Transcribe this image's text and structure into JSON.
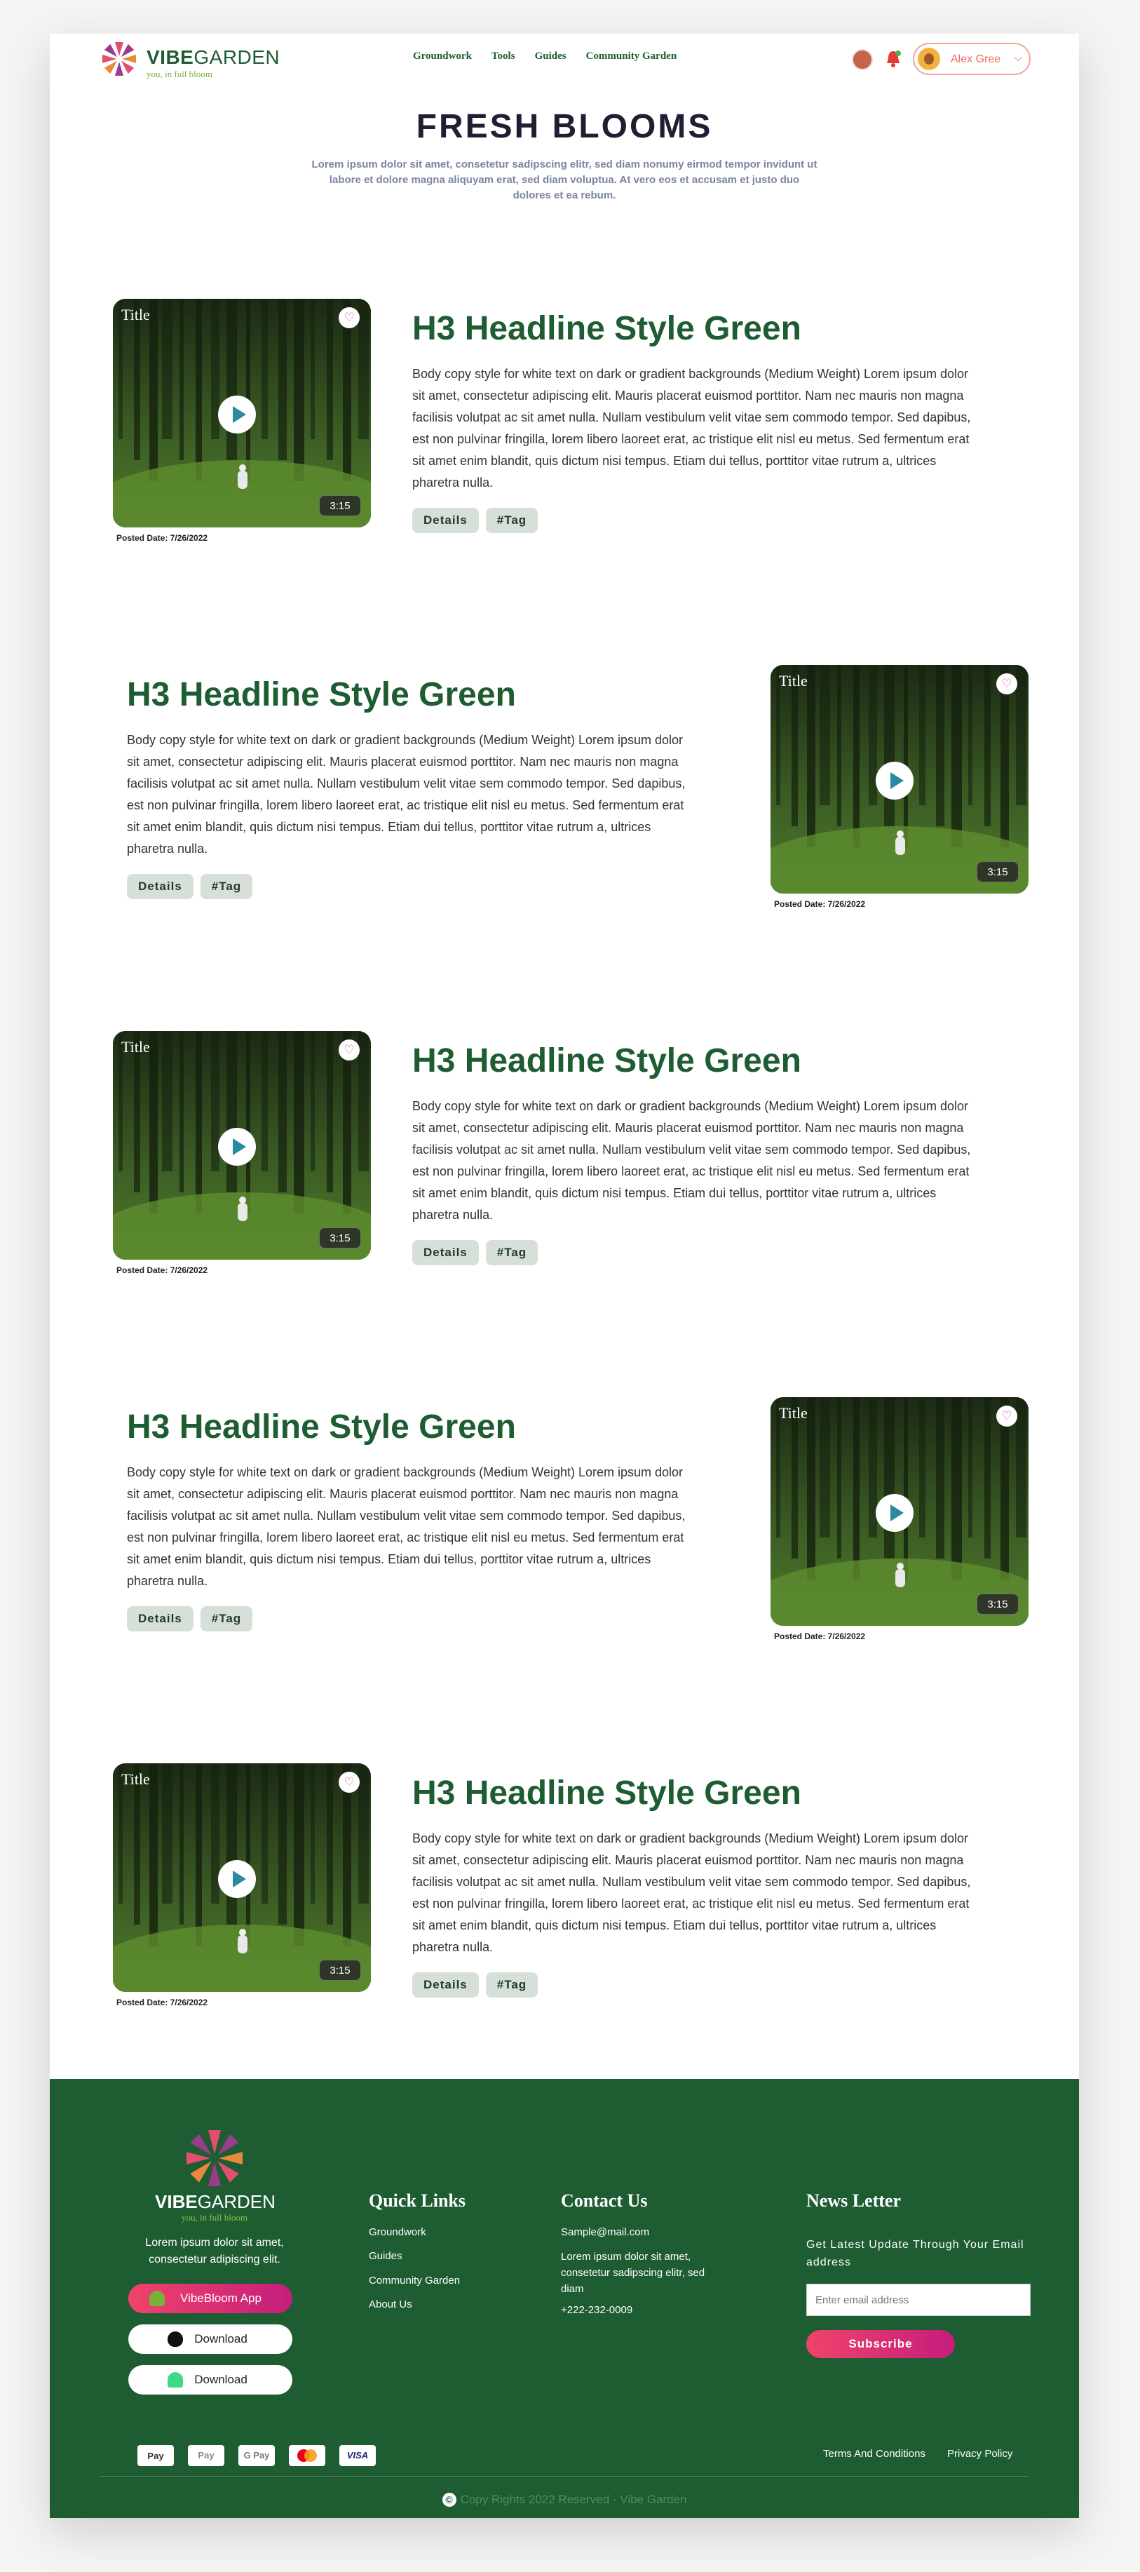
{
  "brand": {
    "name_bold": "VIBE",
    "name_rest": "GARDEN",
    "tagline": "you, in full bloom"
  },
  "nav": [
    "Groundwork",
    "Tools",
    "Guides",
    "Community Garden"
  ],
  "user": {
    "name": "Alex Gree"
  },
  "hero": {
    "title": "FRESH BLOOMS",
    "text": "Lorem ipsum dolor sit amet, consetetur sadipscing elitr, sed diam nonumy eirmod tempor invidunt ut labore et dolore magna aliquyam erat, sed diam voluptua. At vero eos et accusam et justo duo dolores et ea rebum."
  },
  "posts": [
    {
      "media_title": "Title",
      "duration": "3:15",
      "posted": "Posted Date: 7/26/2022",
      "title": "H3 Headline Style Green",
      "body": "Body copy style for white text on dark or gradient backgrounds (Medium Weight) Lorem ipsum dolor sit amet, consectetur adipiscing elit. Mauris placerat euismod porttitor. Nam nec mauris non magna facilisis volutpat ac sit amet nulla. Nullam vestibulum velit vitae sem commodo tempor. Sed dapibus, est non pulvinar fringilla, lorem libero laoreet erat, ac tristique elit nisl eu metus. Sed fermentum erat sit amet enim blandit, quis dictum nisi tempus. Etiam dui tellus, porttitor vitae rutrum a, ultrices pharetra nulla.",
      "tags": [
        "Details",
        "#Tag"
      ]
    },
    {
      "media_title": "Title",
      "duration": "3:15",
      "posted": "Posted Date: 7/26/2022",
      "title": "H3 Headline Style Green",
      "body": "Body copy style for white text on dark or gradient backgrounds (Medium Weight) Lorem ipsum dolor sit amet, consectetur adipiscing elit. Mauris placerat euismod porttitor. Nam nec mauris non magna facilisis volutpat ac sit amet nulla. Nullam vestibulum velit vitae sem commodo tempor. Sed dapibus, est non pulvinar fringilla, lorem libero laoreet erat, ac tristique elit nisl eu metus. Sed fermentum erat sit amet enim blandit, quis dictum nisi tempus. Etiam dui tellus, porttitor vitae rutrum a, ultrices pharetra nulla.",
      "tags": [
        "Details",
        "#Tag"
      ]
    },
    {
      "media_title": "Title",
      "duration": "3:15",
      "posted": "Posted Date: 7/26/2022",
      "title": "H3 Headline Style Green",
      "body": "Body copy style for white text on dark or gradient backgrounds (Medium Weight) Lorem ipsum dolor sit amet, consectetur adipiscing elit. Mauris placerat euismod porttitor. Nam nec mauris non magna facilisis volutpat ac sit amet nulla. Nullam vestibulum velit vitae sem commodo tempor. Sed dapibus, est non pulvinar fringilla, lorem libero laoreet erat, ac tristique elit nisl eu metus. Sed fermentum erat sit amet enim blandit, quis dictum nisi tempus. Etiam dui tellus, porttitor vitae rutrum a, ultrices pharetra nulla.",
      "tags": [
        "Details",
        "#Tag"
      ]
    },
    {
      "media_title": "Title",
      "duration": "3:15",
      "posted": "Posted Date: 7/26/2022",
      "title": "H3 Headline Style Green",
      "body": "Body copy style for white text on dark or gradient backgrounds (Medium Weight) Lorem ipsum dolor sit amet, consectetur adipiscing elit. Mauris placerat euismod porttitor. Nam nec mauris non magna facilisis volutpat ac sit amet nulla. Nullam vestibulum velit vitae sem commodo tempor. Sed dapibus, est non pulvinar fringilla, lorem libero laoreet erat, ac tristique elit nisl eu metus. Sed fermentum erat sit amet enim blandit, quis dictum nisi tempus. Etiam dui tellus, porttitor vitae rutrum a, ultrices pharetra nulla.",
      "tags": [
        "Details",
        "#Tag"
      ]
    },
    {
      "media_title": "Title",
      "duration": "3:15",
      "posted": "Posted Date: 7/26/2022",
      "title": "H3 Headline Style Green",
      "body": "Body copy style for white text on dark or gradient backgrounds (Medium Weight) Lorem ipsum dolor sit amet, consectetur adipiscing elit. Mauris placerat euismod porttitor. Nam nec mauris non magna facilisis volutpat ac sit amet nulla. Nullam vestibulum velit vitae sem commodo tempor. Sed dapibus, est non pulvinar fringilla, lorem libero laoreet erat, ac tristique elit nisl eu metus. Sed fermentum erat sit amet enim blandit, quis dictum nisi tempus. Etiam dui tellus, porttitor vitae rutrum a, ultrices pharetra nulla.",
      "tags": [
        "Details",
        "#Tag"
      ]
    }
  ],
  "footer": {
    "about": "Lorem ipsum dolor sit amet, consectetur adipiscing elit.",
    "app_buttons": [
      "VibeBloom App",
      "Download",
      "Download"
    ],
    "quick_links_title": "Quick Links",
    "quick_links": [
      "Groundwork",
      "Guides",
      "Community Garden",
      "About Us"
    ],
    "contact_title": "Contact Us",
    "email": "Sample@mail.com",
    "address": "Lorem ipsum dolor sit amet, consetetur sadipscing elitr, sed diam",
    "phone": "+222-232-0009",
    "newsletter_title": "News Letter",
    "newsletter_text": "Get Latest Update Through Your Email address",
    "newsletter_placeholder": "Enter email address",
    "subscribe": "Subscribe",
    "payments": [
      "Pay",
      "Pay",
      "G Pay",
      "",
      "VISA"
    ],
    "legal": [
      "Terms And Conditions",
      "Privacy Policy"
    ],
    "copyright": "Copy Rights 2022 Reserved - Vibe Garden"
  },
  "colors": {
    "brand_green": "#1e5c32",
    "accent_pink": "#e0367a",
    "tag_bg": "#d6e0d9",
    "coral": "#ec6e5b"
  }
}
